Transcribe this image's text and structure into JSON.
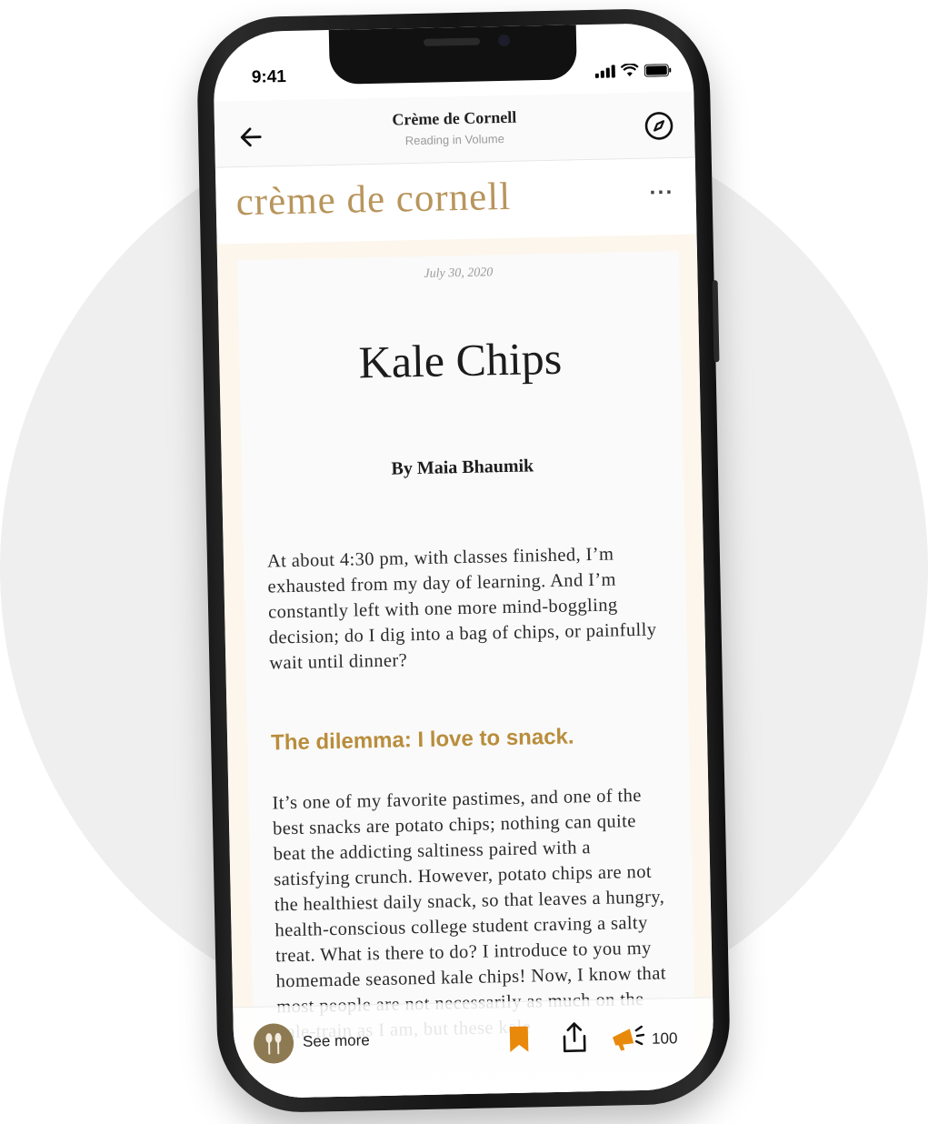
{
  "status_bar": {
    "time": "9:41"
  },
  "nav": {
    "title": "Crème de Cornell",
    "subtitle": "Reading in Volume",
    "back_icon": "arrow-left-icon",
    "compass_icon": "compass-icon"
  },
  "masthead": {
    "title": "crème de cornell",
    "more_label": "···"
  },
  "article": {
    "date": "July 30, 2020",
    "title": "Kale Chips",
    "byline": "By Maia Bhaumik",
    "paragraph_1": "At about 4:30 pm, with classes finished, I’m exhausted from my day of learning. And I’m constantly left with one more mind-boggling decision; do I dig into a bag of chips, or painfully wait until dinner?",
    "subheading": "The dilemma: I love to snack.",
    "paragraph_2": "It’s one of my favorite pastimes, and one of the best snacks are potato chips; nothing can quite beat the addicting saltiness paired with a satisfying crunch. However, potato chips are not the healthiest daily snack, so that leaves a hungry, health-conscious college student craving a salty treat. What is there to do? I introduce to you my homemade seasoned kale chips! Now, I know that most people are not necessarily as much on the kale-train as I am, but these kale"
  },
  "bottom_bar": {
    "see_more": "See more",
    "clap_count": "100"
  },
  "colors": {
    "accent_gold": "#b8955c",
    "subheading_gold": "#b98d3c",
    "bookmark_orange": "#e8890c",
    "page_cream": "#fcf6ec"
  }
}
